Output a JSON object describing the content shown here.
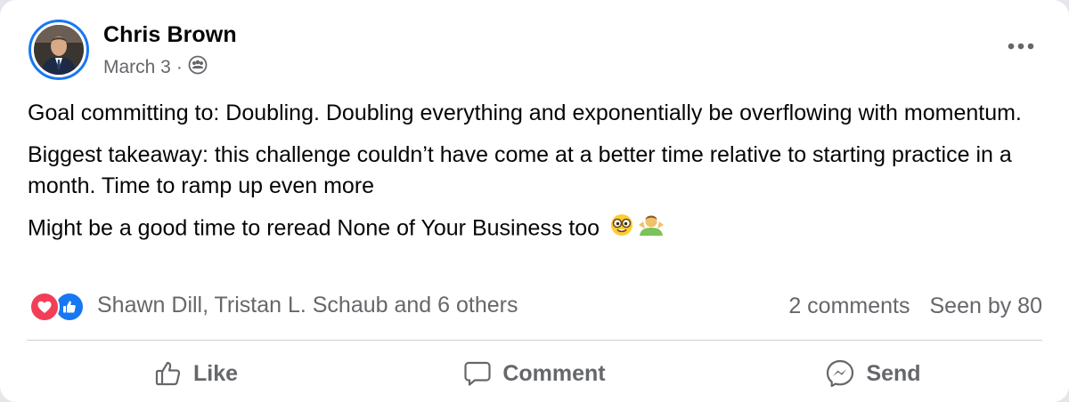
{
  "post": {
    "author": "Chris Brown",
    "date": "March 3",
    "separator": "·",
    "audience_icon": "group-audience-icon",
    "paragraphs": [
      "Goal committing to: Doubling. Doubling everything and exponentially be overflowing with momentum.",
      "Biggest takeaway: this challenge couldn’t have come at a better time relative to starting practice in a month. Time to ramp up even more",
      "Might be a good time to reread None of Your Business too"
    ],
    "emojis": [
      "nerd-face-emoji",
      "man-shrugging-emoji"
    ]
  },
  "reactions": {
    "icons": [
      "love-reaction-icon",
      "like-reaction-icon"
    ],
    "summary": "Shawn Dill, Tristan L. Schaub and 6 others"
  },
  "stats": {
    "comments": "2 comments",
    "seen": "Seen by 80"
  },
  "actions": {
    "like": "Like",
    "comment": "Comment",
    "send": "Send"
  },
  "colors": {
    "accent": "#1877f2",
    "love": "#f33e58",
    "secondary_text": "#65676b"
  }
}
